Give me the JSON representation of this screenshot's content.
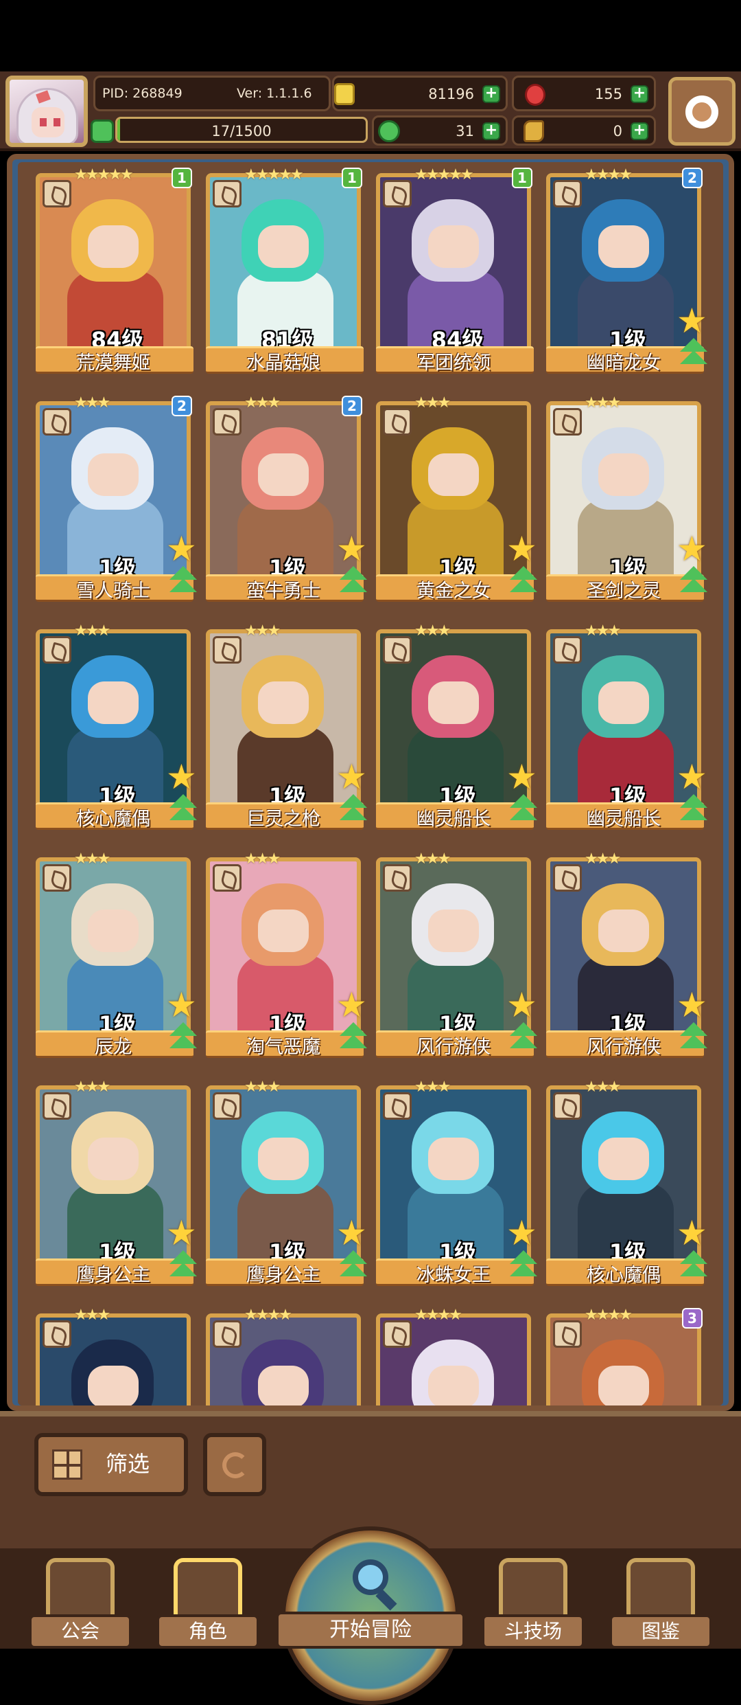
{
  "header": {
    "pid": "PID: 268849",
    "version": "Ver: 1.1.1.6",
    "gold": "81196",
    "gems": "155",
    "xp": "17/1500",
    "xp_fraction": 0.011,
    "clover": "31",
    "material": "0"
  },
  "colors": {
    "gold_coin": "#f2d24a",
    "gem": "#e04040",
    "clover": "#4fc15a",
    "material": "#e0b040",
    "badge_green": "#55b53f",
    "badge_blue": "#3f8fdc",
    "badge_purple": "#9a68c8"
  },
  "cards": [
    {
      "level": "84级",
      "name": "荒漠舞姬",
      "stars": "★★★★★",
      "badge": "1",
      "badge_type": "green",
      "hair": "#f0b84a",
      "outfit": "#c24a36",
      "bg": "#d98a52",
      "show_upgrade": false
    },
    {
      "level": "81级",
      "name": "水晶菇娘",
      "stars": "★★★★★",
      "badge": "1",
      "badge_type": "green",
      "hair": "#3fd2b6",
      "outfit": "#e8f4f0",
      "bg": "#6ab8c8",
      "show_upgrade": false
    },
    {
      "level": "84级",
      "name": "军团统领",
      "stars": "★★★★★",
      "badge": "1",
      "badge_type": "green",
      "hair": "#d8d2e6",
      "outfit": "#7a5aa8",
      "bg": "#4a3a6a",
      "show_upgrade": false
    },
    {
      "level": "1级",
      "name": "幽暗龙女",
      "stars": "★★★★",
      "badge": "2",
      "badge_type": "blue",
      "hair": "#2e7cb8",
      "outfit": "#3a4a6a",
      "bg": "#2a4a6a",
      "show_upgrade": true
    },
    {
      "level": "1级",
      "name": "雪人骑士",
      "stars": "★★★",
      "badge": "2",
      "badge_type": "blue",
      "hair": "#e4ecf6",
      "outfit": "#8ab4d8",
      "bg": "#5a8ab8",
      "show_upgrade": true
    },
    {
      "level": "1级",
      "name": "蛮牛勇士",
      "stars": "★★★",
      "badge": "2",
      "badge_type": "blue",
      "hair": "#e8887a",
      "outfit": "#a06a4a",
      "bg": "#8a6a5a",
      "show_upgrade": true
    },
    {
      "level": "1级",
      "name": "黄金之女",
      "stars": "★★★",
      "badge": "",
      "badge_type": "none",
      "hair": "#d8a82a",
      "outfit": "#c89a2a",
      "bg": "#6a4a2a",
      "show_upgrade": true
    },
    {
      "level": "1级",
      "name": "圣剑之灵",
      "stars": "★★★",
      "badge": "",
      "badge_type": "none",
      "hair": "#d4dce8",
      "outfit": "#b8a888",
      "bg": "#e8e4d8",
      "show_upgrade": true
    },
    {
      "level": "1级",
      "name": "核心魔偶",
      "stars": "★★★",
      "badge": "",
      "badge_type": "none",
      "hair": "#3a9ad8",
      "outfit": "#2a5a7a",
      "bg": "#1a4a5a",
      "show_upgrade": true
    },
    {
      "level": "1级",
      "name": "巨灵之枪",
      "stars": "★★★",
      "badge": "",
      "badge_type": "none",
      "hair": "#e8b85a",
      "outfit": "#5a3a2a",
      "bg": "#c8b8a8",
      "show_upgrade": true
    },
    {
      "level": "1级",
      "name": "幽灵船长",
      "stars": "★★★",
      "badge": "",
      "badge_type": "none",
      "hair": "#d85a7a",
      "outfit": "#2a4a3a",
      "bg": "#3a4a3a",
      "show_upgrade": true
    },
    {
      "level": "1级",
      "name": "幽灵船长",
      "stars": "★★★",
      "badge": "",
      "badge_type": "none",
      "hair": "#4ab8a8",
      "outfit": "#a82a3a",
      "bg": "#3a5a6a",
      "show_upgrade": true
    },
    {
      "level": "1级",
      "name": "辰龙",
      "stars": "★★★",
      "badge": "",
      "badge_type": "none",
      "hair": "#e8dcc8",
      "outfit": "#4a8ab8",
      "bg": "#7aa8a8",
      "show_upgrade": true
    },
    {
      "level": "1级",
      "name": "淘气恶魔",
      "stars": "★★★",
      "badge": "",
      "badge_type": "none",
      "hair": "#e89a6a",
      "outfit": "#d85a6a",
      "bg": "#e8a8b8",
      "show_upgrade": true
    },
    {
      "level": "1级",
      "name": "风行游侠",
      "stars": "★★★",
      "badge": "",
      "badge_type": "none",
      "hair": "#e8e8ec",
      "outfit": "#3a6a5a",
      "bg": "#5a6a5a",
      "show_upgrade": true
    },
    {
      "level": "1级",
      "name": "风行游侠",
      "stars": "★★★",
      "badge": "",
      "badge_type": "none",
      "hair": "#e8b85a",
      "outfit": "#2a2a3a",
      "bg": "#4a5a7a",
      "show_upgrade": true
    },
    {
      "level": "1级",
      "name": "鹰身公主",
      "stars": "★★★",
      "badge": "",
      "badge_type": "none",
      "hair": "#f0d8a8",
      "outfit": "#3a6a5a",
      "bg": "#6a8a9a",
      "show_upgrade": true
    },
    {
      "level": "1级",
      "name": "鹰身公主",
      "stars": "★★★",
      "badge": "",
      "badge_type": "none",
      "hair": "#5ad8d8",
      "outfit": "#7a5a4a",
      "bg": "#4a7a9a",
      "show_upgrade": true
    },
    {
      "level": "1级",
      "name": "冰蛛女王",
      "stars": "★★★",
      "badge": "",
      "badge_type": "none",
      "hair": "#7ad8e8",
      "outfit": "#3a7a9a",
      "bg": "#2a5a7a",
      "show_upgrade": true
    },
    {
      "level": "1级",
      "name": "核心魔偶",
      "stars": "★★★",
      "badge": "",
      "badge_type": "none",
      "hair": "#4ac8e8",
      "outfit": "#2a3a4a",
      "bg": "#3a4a5a",
      "show_upgrade": true
    },
    {
      "level": "",
      "name": "",
      "stars": "★★★",
      "badge": "",
      "badge_type": "none",
      "hair": "#1a2a4a",
      "outfit": "#3a5a7a",
      "bg": "#2a4a6a",
      "show_upgrade": false
    },
    {
      "level": "",
      "name": "",
      "stars": "★★★★",
      "badge": "",
      "badge_type": "none",
      "hair": "#4a3a7a",
      "outfit": "#3a4a6a",
      "bg": "#5a5a7a",
      "show_upgrade": false
    },
    {
      "level": "",
      "name": "",
      "stars": "★★★★",
      "badge": "",
      "badge_type": "none",
      "hair": "#e8e0f0",
      "outfit": "#4a8a3a",
      "bg": "#5a3a6a",
      "show_upgrade": false
    },
    {
      "level": "",
      "name": "",
      "stars": "★★★★",
      "badge": "3",
      "badge_type": "purple",
      "hair": "#c86a3a",
      "outfit": "#8a4a2a",
      "bg": "#a86a4a",
      "show_upgrade": false
    }
  ],
  "controls": {
    "filter_label": "筛选"
  },
  "tabs": {
    "guild": "公会",
    "character": "角色",
    "adventure": "开始冒险",
    "arena": "斗技场",
    "codex": "图鉴"
  }
}
